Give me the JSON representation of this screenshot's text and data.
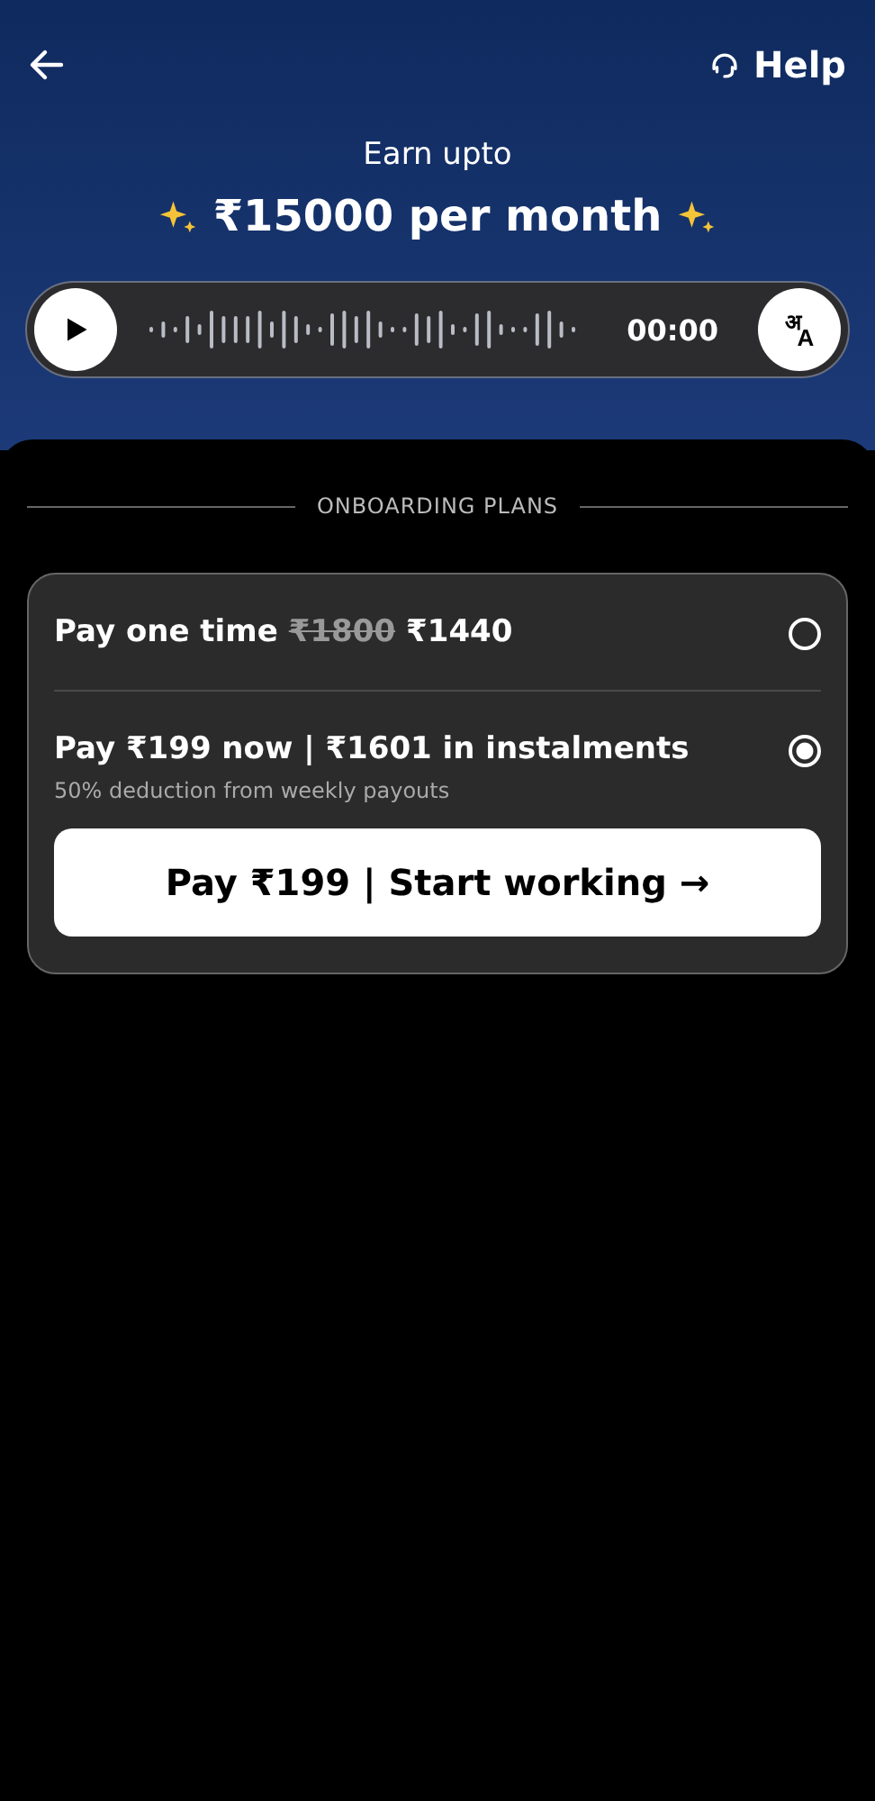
{
  "header": {
    "help_label": "Help",
    "earn_label": "Earn upto",
    "earn_amount": "₹15000 per month"
  },
  "audio_player": {
    "time": "00:00",
    "language_button": {
      "script_glyph": "अ",
      "latin_glyph": "A"
    }
  },
  "section_title": "ONBOARDING PLANS",
  "plans": [
    {
      "label": "Pay one time",
      "old_price": "₹1800",
      "price": "₹1440",
      "selected": false
    },
    {
      "label": "Pay ₹199 now | ₹1601 in instalments",
      "note": "50% deduction from weekly payouts",
      "selected": true
    }
  ],
  "cta_button": "Pay ₹199 | Start working →"
}
